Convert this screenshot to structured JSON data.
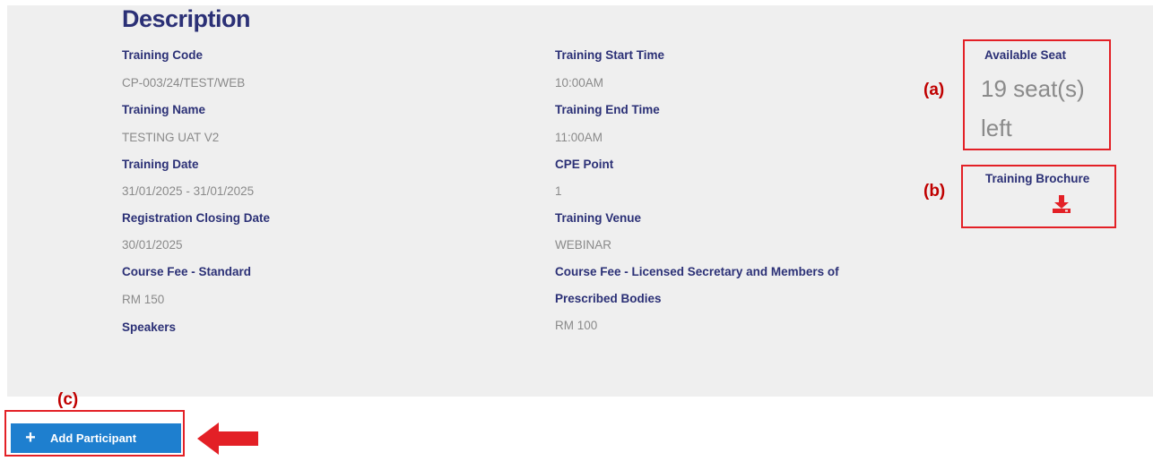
{
  "description": {
    "heading": "Description",
    "left_fields": [
      {
        "label": "Training Code",
        "value": "CP-003/24/TEST/WEB"
      },
      {
        "label": "Training Name",
        "value": "TESTING UAT V2"
      },
      {
        "label": "Training Date",
        "value": "31/01/2025 - 31/01/2025"
      },
      {
        "label": "Registration Closing Date",
        "value": "30/01/2025"
      },
      {
        "label": "Course Fee - Standard",
        "value": "RM 150"
      },
      {
        "label": "Speakers",
        "value": ""
      }
    ],
    "right_fields": [
      {
        "label": "Training Start Time",
        "value": "10:00AM"
      },
      {
        "label": "Training End Time",
        "value": "11:00AM"
      },
      {
        "label": "CPE Point",
        "value": "1"
      },
      {
        "label": "Training Venue",
        "value": "WEBINAR"
      },
      {
        "label_line1": "Course Fee - Licensed Secretary and Members of",
        "label_line2": "Prescribed Bodies",
        "value": "RM 100"
      }
    ]
  },
  "seat": {
    "label": "Available Seat",
    "line1": "19 seat(s)",
    "line2": "left"
  },
  "brochure": {
    "label": "Training Brochure",
    "icon": "download-icon"
  },
  "annotations": {
    "a": "(a)",
    "b": "(b)",
    "c": "(c)"
  },
  "add_participant": {
    "label": "Add Participant",
    "icon": "plus-icon"
  },
  "colors": {
    "label": "#2b3076",
    "value": "#8a8a8a",
    "annotation": "#e32026",
    "button": "#1e7fcf",
    "panel": "#efefef"
  }
}
